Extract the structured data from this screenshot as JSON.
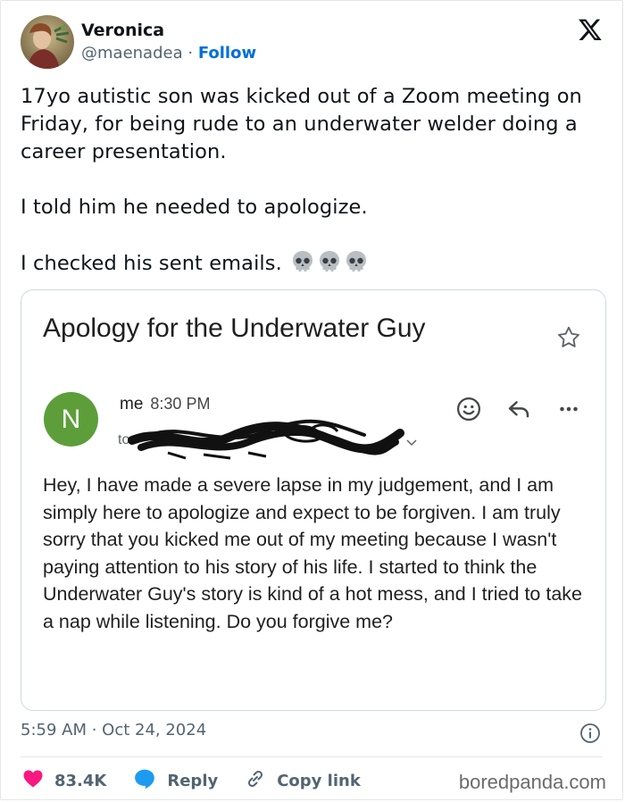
{
  "author": {
    "name": "Veronica",
    "handle": "@maenadea",
    "separator": "·",
    "follow_label": "Follow"
  },
  "tweet": {
    "paragraphs": [
      "17yo autistic son was kicked out of a Zoom meeting on Friday, for being rude to an underwater welder doing a career presentation.",
      "I told him he needed to apologize.",
      "I checked his sent emails."
    ],
    "emoji": [
      "skull-icon",
      "skull-icon",
      "skull-icon"
    ]
  },
  "email": {
    "subject": "Apology for the Underwater Guy",
    "avatar_letter": "N",
    "sender": "me",
    "time": "8:30 PM",
    "to_prefix": "to",
    "body": "Hey, I have made a severe lapse in my judgement, and I am simply here to apologize and expect to be forgiven. I am truly sorry that you kicked me out of my meeting because I wasn't paying attention to his story of his life. I started to think the Underwater Guy's story is kind of a hot mess, and I tried to take a nap while listening. Do you forgive me?",
    "avatar_color": "#5d9e3a"
  },
  "footer": {
    "timestamp": "5:59 AM · Oct 24, 2024",
    "likes": "83.4K",
    "reply_label": "Reply",
    "copy_link_label": "Copy link",
    "watermark": "boredpanda.com"
  },
  "colors": {
    "follow": "#006fd6",
    "heart": "#f91880",
    "reply": "#1d9bf0"
  }
}
